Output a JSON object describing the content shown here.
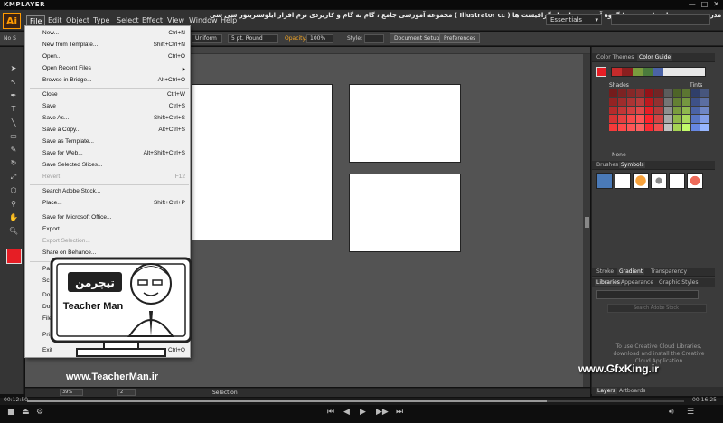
{
  "player": {
    "logo": "KMPLAYER",
    "title": "مجموعه آموزشی جامع ، گام به گام و کاربردی نرم افزار ایلوستریتور سی سی ( Illustrator cc ) مدرس : سعید هدایی ( تیچرمن ) گروه آموزشی پادشاه گرافیست ها",
    "window_buttons": [
      "—",
      "□",
      "✕"
    ],
    "time_elapsed": "00:12:50",
    "time_total": "00:16:25",
    "progress_fraction": 0.79
  },
  "menubar": {
    "items": [
      "File",
      "Edit",
      "Object",
      "Type",
      "Select",
      "Effect",
      "View",
      "Window",
      "Help"
    ],
    "active": "File",
    "workspace": "Essentials"
  },
  "control_bar": {
    "selection_label": "No S",
    "profile": "Uniform",
    "brush": "5 pt. Round",
    "opacity_label": "Opacity:",
    "opacity_value": "100%",
    "style_label": "Style:",
    "document_setup": "Document Setup",
    "preferences": "Preferences"
  },
  "file_menu": [
    {
      "label": "New...",
      "shortcut": "Ctrl+N"
    },
    {
      "label": "New from Template...",
      "shortcut": "Shift+Ctrl+N"
    },
    {
      "label": "Open...",
      "shortcut": "Ctrl+O"
    },
    {
      "label": "Open Recent Files",
      "shortcut": "▸"
    },
    {
      "label": "Browse in Bridge...",
      "shortcut": "Alt+Ctrl+O"
    },
    {
      "label": "Close",
      "shortcut": "Ctrl+W"
    },
    {
      "label": "Save",
      "shortcut": "Ctrl+S"
    },
    {
      "label": "Save As...",
      "shortcut": "Shift+Ctrl+S"
    },
    {
      "label": "Save a Copy...",
      "shortcut": "Alt+Ctrl+S"
    },
    {
      "label": "Save as Template...",
      "shortcut": ""
    },
    {
      "label": "Save for Web...",
      "shortcut": "Alt+Shift+Ctrl+S"
    },
    {
      "label": "Save Selected Slices...",
      "shortcut": ""
    },
    {
      "label": "Revert",
      "shortcut": "F12"
    },
    {
      "label": "Search Adobe Stock...",
      "shortcut": ""
    },
    {
      "label": "Place...",
      "shortcut": "Shift+Ctrl+P"
    },
    {
      "label": "Save for Microsoft Office...",
      "shortcut": ""
    },
    {
      "label": "Export...",
      "shortcut": ""
    },
    {
      "label": "Export Selection...",
      "shortcut": ""
    },
    {
      "label": "Share on Behance...",
      "shortcut": ""
    },
    {
      "label": "Pa",
      "shortcut": ""
    },
    {
      "label": "Sc",
      "shortcut": ""
    },
    {
      "label": "Do",
      "shortcut": ""
    },
    {
      "label": "Do",
      "shortcut": ""
    },
    {
      "label": "File",
      "shortcut": ""
    },
    {
      "label": "Print",
      "shortcut": ""
    },
    {
      "label": "Exit",
      "shortcut": "Ctrl+Q"
    }
  ],
  "right_panels": {
    "color_tabs": [
      "Color Themes",
      "Color Guide"
    ],
    "shades": "Shades",
    "tints": "Tints",
    "none": "None",
    "symbol_tabs": [
      "Brushes",
      "Symbols"
    ],
    "stroke_tabs": [
      "Stroke",
      "Gradient",
      "Transparency"
    ],
    "library_tabs": [
      "Libraries",
      "Appearance",
      "Graphic Styles"
    ],
    "search_placeholder": "Search Adobe Stock",
    "cc_message": "To use Creative Cloud Libraries, download and install the Creative Cloud Application",
    "layer_tabs": [
      "Layers",
      "Artboards"
    ]
  },
  "status_bar": {
    "zoom": "39%",
    "artboard": "2",
    "tool": "Selection"
  },
  "watermark": {
    "teacher_logo": "تیچرمن",
    "teacher_name": "Teacher Man",
    "teacher_url": "www.TeacherMan.ir",
    "gfx_url": "www.GfxKing.ir"
  },
  "colors": {
    "fill": "#e61e25",
    "ai_orange": "#ff9a00",
    "guide_base": [
      "#c42b2b",
      "#8a1f1f",
      "#4b7b3d",
      "#7a9c3e",
      "#4b63a6"
    ]
  }
}
